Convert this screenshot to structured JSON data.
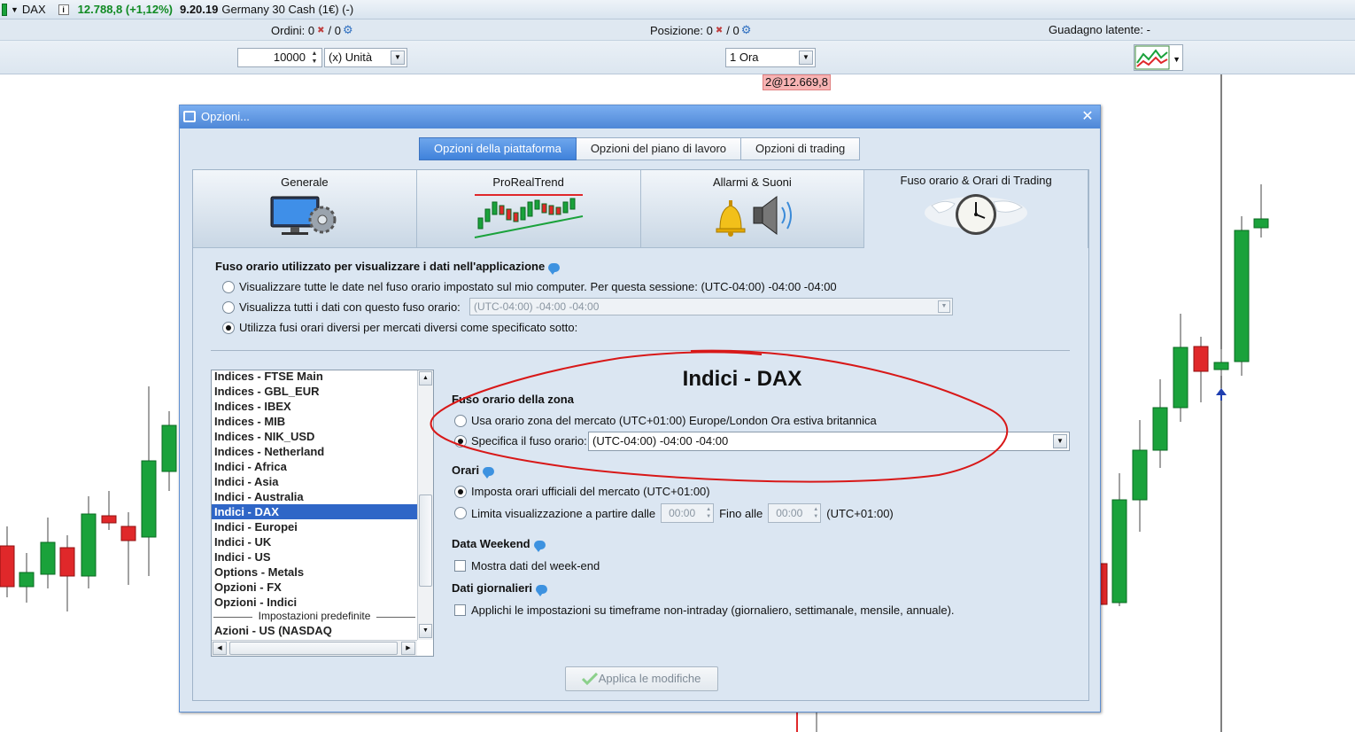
{
  "topbar": {
    "symbol": "DAX",
    "price": "12.788,8 (+1,12%)",
    "time": "9.20.19",
    "instrument": "Germany 30 Cash (1€) (-)"
  },
  "bar2": {
    "orders_label": "Ordini:",
    "orders_value": "0",
    "orders_value2": "0",
    "positions_label": "Posizione:",
    "positions_value": "0",
    "positions_value2": "0",
    "latent_label": "Guadagno latente:",
    "latent_value": "-"
  },
  "bar3": {
    "quantity": "10000",
    "unit": "(x) Unità",
    "timeframe": "1 Ora"
  },
  "price_tag": "2@12.669,8",
  "dialog": {
    "title": "Opzioni...",
    "seg_tabs": [
      "Opzioni della piattaforma",
      "Opzioni del piano di lavoro",
      "Opzioni di trading"
    ],
    "big_tabs": [
      "Generale",
      "ProRealTrend",
      "Allarmi & Suoni",
      "Fuso orario & Orari di Trading"
    ],
    "tz_section_title": "Fuso orario utilizzato per visualizzare i dati nell'applicazione",
    "tz_option_1": "Visualizzare tutte le date nel fuso orario impostato sul mio computer. Per questa sessione: (UTC-04:00) -04:00 -04:00",
    "tz_option_2": "Visualizza tutti i dati con questo fuso orario:",
    "tz_option_2_value": "(UTC-04:00) -04:00 -04:00",
    "tz_option_3": "Utilizza fusi orari diversi per mercati diversi come specificato sotto:",
    "market_list": [
      "Indices - FTSE Main",
      "Indices - GBL_EUR",
      "Indices - IBEX",
      "Indices - MIB",
      "Indices - NIK_USD",
      "Indices - Netherland",
      "Indici - Africa",
      "Indici - Asia",
      "Indici - Australia",
      "Indici - DAX",
      "Indici - Europei",
      "Indici - UK",
      "Indici - US",
      "Options - Metals",
      "Opzioni - FX",
      "Opzioni - Indici"
    ],
    "list_divider": "Impostazioni predefinite",
    "list_after_divider": "Azioni - US (NASDAQ",
    "market_title": "Indici - DAX",
    "zone_title": "Fuso orario della zona",
    "zone_option_1": "Usa orario zona del mercato (UTC+01:00) Europe/London Ora estiva britannica",
    "zone_option_2": "Specifica il fuso orario:",
    "zone_value": "(UTC-04:00) -04:00 -04:00",
    "hours_title": "Orari",
    "hours_option_1": "Imposta orari ufficiali del mercato  (UTC+01:00)",
    "hours_option_2": "Limita visualizzazione  a partire dalle",
    "hours_from": "00:00",
    "hours_to_label": "Fino alle",
    "hours_to": "00:00",
    "hours_tz": "(UTC+01:00)",
    "weekend_title": "Data Weekend",
    "weekend_option": "Mostra dati del week-end",
    "daily_title": "Dati giornalieri",
    "daily_option": "Applichi le impostazioni su timeframe non-intraday (giornaliero, settimanale, mensile, annuale).",
    "apply_button": "Applica le modifiche"
  },
  "colors": {
    "bull": "#1aa23b",
    "bear": "#e0282a",
    "accent": "#3f82db",
    "annotation": "#d81818"
  }
}
